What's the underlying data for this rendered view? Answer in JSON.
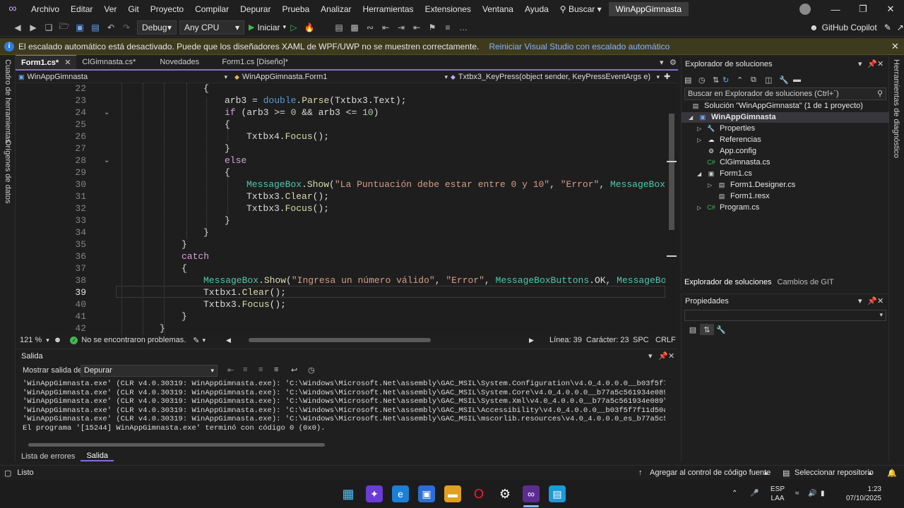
{
  "menu": {
    "items": [
      "Archivo",
      "Editar",
      "Ver",
      "Git",
      "Proyecto",
      "Compilar",
      "Depurar",
      "Prueba",
      "Analizar",
      "Herramientas",
      "Extensiones",
      "Ventana",
      "Ayuda"
    ],
    "search": "Buscar",
    "solution_badge": "WinAppGimnasta"
  },
  "toolbar": {
    "config": "Debug",
    "platform": "Any CPU",
    "run_label": "Iniciar",
    "copilot": "GitHub Copilot"
  },
  "infobar": {
    "message": "El escalado automático está desactivado. Puede que los diseñadores XAML de WPF/UWP no se muestren correctamente.",
    "link": "Reiniciar Visual Studio con escalado automático"
  },
  "left_strip": {
    "toolbox": "Cuadro de herramientas",
    "datasources": "Orígenes de datos"
  },
  "right_strip": {
    "diagnostics": "Herramientas de diagnóstico"
  },
  "tabs": [
    {
      "label": "Form1.cs*",
      "active": true
    },
    {
      "label": "ClGimnasta.cs*",
      "active": false
    },
    {
      "label": "Novedades",
      "active": false
    },
    {
      "label": "Form1.cs [Diseño]*",
      "active": false
    }
  ],
  "navbar": {
    "project": "WinAppGimnasta",
    "type": "WinAppGimnasta.Form1",
    "member": "Txtbx3_KeyPress(object sender, KeyPressEventArgs e)"
  },
  "editor": {
    "lines": [
      {
        "n": "22"
      },
      {
        "n": "23"
      },
      {
        "n": "24"
      },
      {
        "n": "25"
      },
      {
        "n": "26"
      },
      {
        "n": "27"
      },
      {
        "n": "28"
      },
      {
        "n": "29"
      },
      {
        "n": "30"
      },
      {
        "n": "31"
      },
      {
        "n": "32"
      },
      {
        "n": "33"
      },
      {
        "n": "34"
      },
      {
        "n": "35"
      },
      {
        "n": "36"
      },
      {
        "n": "37"
      },
      {
        "n": "38"
      },
      {
        "n": "39"
      },
      {
        "n": "40"
      },
      {
        "n": "41"
      },
      {
        "n": "42"
      }
    ],
    "current_line": "39"
  },
  "editor_status": {
    "zoom": "121 %",
    "problems": "No se encontraron problemas.",
    "line": "Línea: 39",
    "column": "Carácter: 23",
    "spc": "SPC",
    "eol": "CRLF"
  },
  "output": {
    "title": "Salida",
    "show_label": "Mostrar salida de:",
    "source": "Depurar",
    "lines": [
      "'WinAppGimnasta.exe' (CLR v4.0.30319: WinAppGimnasta.exe): 'C:\\Windows\\Microsoft.Net\\assembly\\GAC_MSIL\\System.Configuration\\v4.0_4.0.0.0__b03f5f7f11d50a3a\\",
      "'WinAppGimnasta.exe' (CLR v4.0.30319: WinAppGimnasta.exe): 'C:\\Windows\\Microsoft.Net\\assembly\\GAC_MSIL\\System.Core\\v4.0_4.0.0.0__b77a5c561934e089\\System.Co",
      "'WinAppGimnasta.exe' (CLR v4.0.30319: WinAppGimnasta.exe): 'C:\\Windows\\Microsoft.Net\\assembly\\GAC_MSIL\\System.Xml\\v4.0_4.0.0.0__b77a5c561934e089\\System.Xml",
      "'WinAppGimnasta.exe' (CLR v4.0.30319: WinAppGimnasta.exe): 'C:\\Windows\\Microsoft.Net\\assembly\\GAC_MSIL\\Accessibility\\v4.0_4.0.0.0__b03f5f7f11d50a3a\\Accessi",
      "'WinAppGimnasta.exe' (CLR v4.0.30319: WinAppGimnasta.exe): 'C:\\Windows\\Microsoft.Net\\assembly\\GAC_MSIL\\mscorlib.resources\\v4.0_4.0.0.0_es_b77a5c561934e089\\",
      "El programa '[15244] WinAppGimnasta.exe' terminó con código 0 (0x0)."
    ]
  },
  "bottom_tabs": [
    "Lista de errores",
    "Salida"
  ],
  "solution_explorer": {
    "title": "Explorador de soluciones",
    "search_placeholder": "Buscar en Explorador de soluciones (Ctrl+´)",
    "solution": "Solución \"WinAppGimnasta\" (1 de 1 proyecto)",
    "project": "WinAppGimnasta",
    "items": [
      "Properties",
      "Referencias",
      "App.config",
      "ClGimnasta.cs",
      "Form1.cs",
      "Form1.Designer.cs",
      "Form1.resx",
      "Program.cs"
    ],
    "tab_active": "Explorador de soluciones",
    "tab_other": "Cambios de GIT"
  },
  "properties": {
    "title": "Propiedades"
  },
  "statusbar": {
    "ready": "Listo",
    "source_control": "Agregar al control de código fuente",
    "repo": "Seleccionar repositorio"
  },
  "taskbar": {
    "lang": "ESP",
    "layout": "LAA",
    "time": "1:23",
    "date": "07/10/2025"
  },
  "colors": {
    "accent": "#8a6be0",
    "keyword": "#569cd6",
    "class": "#4ec9b0",
    "method": "#dcdcaa",
    "string": "#d69d85"
  }
}
